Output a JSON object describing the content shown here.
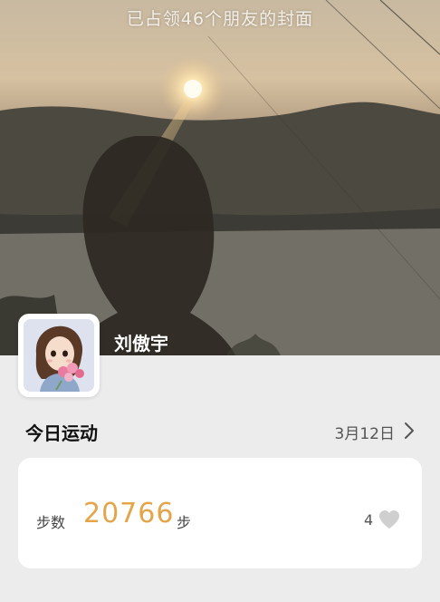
{
  "cover": {
    "caption": "已占领46个朋友的封面"
  },
  "profile": {
    "name": "刘傲宇"
  },
  "today": {
    "title": "今日运动",
    "date": "3月12日"
  },
  "steps": {
    "label": "步数",
    "value": "20766",
    "unit": "步",
    "likes": "4"
  },
  "colors": {
    "accent": "#e6a44a",
    "background": "#ececec"
  }
}
